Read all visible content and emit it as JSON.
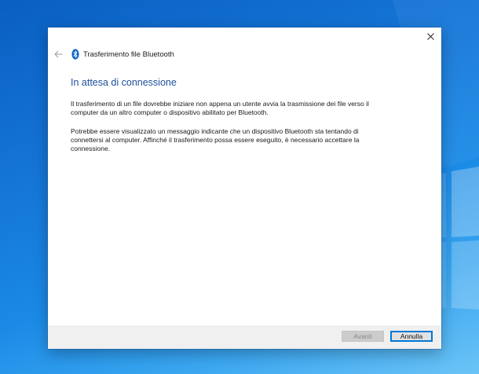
{
  "window": {
    "title": "Trasferimento file Bluetooth",
    "close_icon": "close-icon",
    "back_icon": "back-arrow-icon",
    "bluetooth_icon": "bluetooth-icon"
  },
  "content": {
    "heading": "In attesa di connessione",
    "paragraph1": "Il trasferimento di un file dovrebbe iniziare non appena un utente avvia la trasmissione dei file verso il computer da un altro computer o dispositivo abilitato per Bluetooth.",
    "paragraph2": "Potrebbe essere visualizzato un messaggio indicante che un dispositivo Bluetooth sta tentando di connettersi al computer. Affinché il trasferimento possa essere eseguito, è necessario accettare la connessione."
  },
  "footer": {
    "next_label": "Avanti",
    "cancel_label": "Annulla"
  },
  "colors": {
    "heading": "#1e4f9c",
    "accent": "#0078d7",
    "bluetooth": "#0b62c4"
  }
}
